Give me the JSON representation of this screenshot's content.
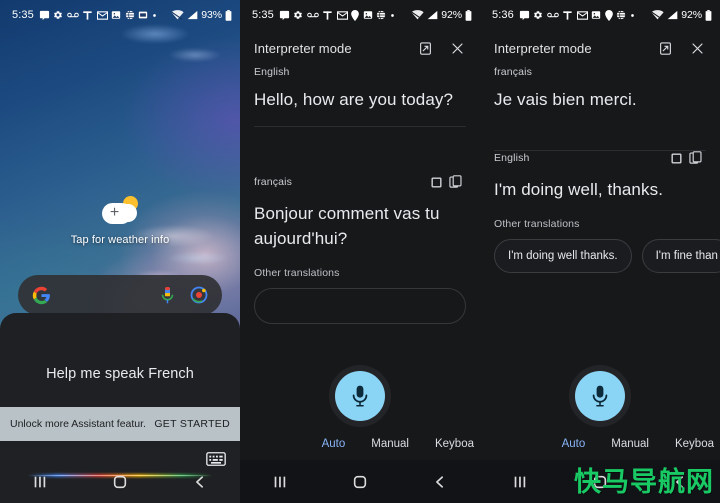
{
  "panels": [
    {
      "status": {
        "time": "5:35",
        "battery": "93%"
      },
      "home": {
        "weather_label": "Tap for weather info",
        "search_logo": "google-g-logo",
        "mic_icon": "microphone-icon",
        "lens_icon": "google-lens-icon"
      },
      "assistant": {
        "query": "Help me speak French",
        "promo_text": "Unlock more Assistant featur...",
        "promo_cta": "GET STARTED",
        "keyboard_icon": "keyboard-icon"
      }
    },
    {
      "status": {
        "time": "5:35",
        "battery": "92%"
      },
      "header": {
        "title": "Interpreter mode",
        "expand_icon": "open-in-new-icon",
        "close_icon": "close-icon"
      },
      "segments": [
        {
          "lang": "English",
          "text": "Hello, how are you today?",
          "has_icons": false
        },
        {
          "lang": "français",
          "text": "Bonjour comment vas tu aujourd'hui?",
          "has_icons": true,
          "fullscreen_icon": "fullscreen-icon",
          "copy_icon": "copy-icon"
        }
      ],
      "other_label": "Other translations",
      "other_chips": [],
      "tabs": [
        {
          "label": "Auto",
          "active": true
        },
        {
          "label": "Manual",
          "active": false
        },
        {
          "label": "Keyboa",
          "active": false
        }
      ],
      "mic_icon": "microphone-icon"
    },
    {
      "status": {
        "time": "5:36",
        "battery": "92%"
      },
      "header": {
        "title": "Interpreter mode",
        "expand_icon": "open-in-new-icon",
        "close_icon": "close-icon"
      },
      "segments": [
        {
          "lang": "français",
          "text": "Je vais bien merci.",
          "has_icons": false
        },
        {
          "lang": "English",
          "text": "I'm doing well, thanks.",
          "has_icons": true,
          "fullscreen_icon": "fullscreen-icon",
          "copy_icon": "copy-icon"
        }
      ],
      "other_label": "Other translations",
      "other_chips": [
        "I'm doing well thanks.",
        "I'm fine than"
      ],
      "tabs": [
        {
          "label": "Auto",
          "active": true
        },
        {
          "label": "Manual",
          "active": false
        },
        {
          "label": "Keyboa",
          "active": false
        }
      ],
      "mic_icon": "microphone-icon"
    }
  ],
  "navbar": {
    "recents_icon": "recents-icon",
    "home_icon": "home-icon",
    "back_icon": "back-icon"
  },
  "watermark": {
    "text": "快马导航网",
    "color": "#18c964"
  },
  "colors": {
    "accent_blue": "#8ab4f8",
    "mic_blue": "#8ad4f5",
    "panel_bg": "#17181a",
    "text_primary": "#e8eaed",
    "text_secondary": "#bdc1c6"
  }
}
